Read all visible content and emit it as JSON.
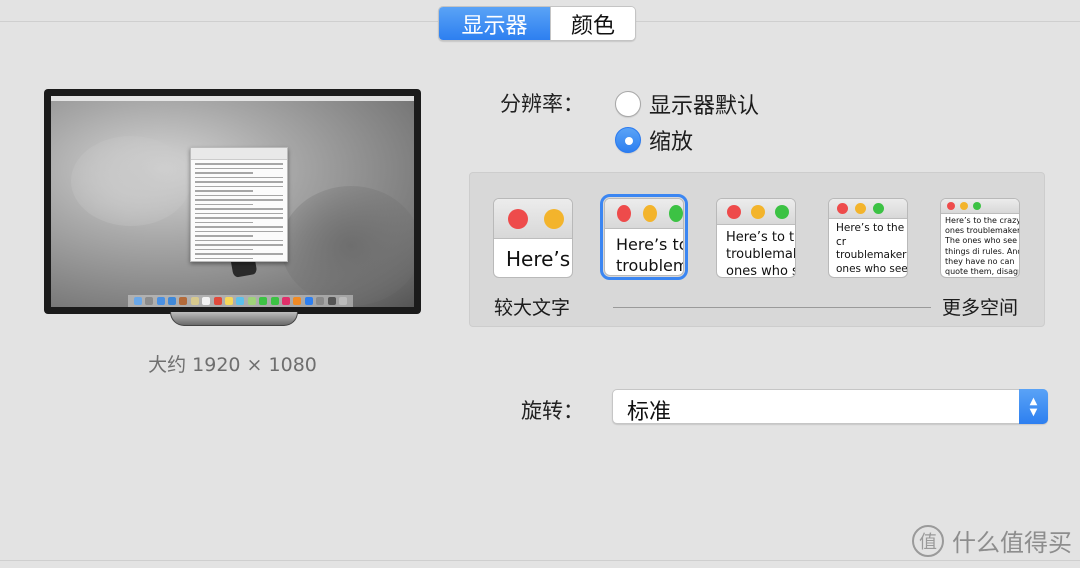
{
  "tabs": {
    "display": "显示器",
    "color": "颜色",
    "active": "display"
  },
  "monitor": {
    "caption": "大约 1920 × 1080"
  },
  "resolution": {
    "label": "分辨率：",
    "options": [
      {
        "label": "显示器默认",
        "selected": false
      },
      {
        "label": "缩放",
        "selected": true
      }
    ],
    "scale_min_label": "较大文字",
    "scale_max_label": "更多空间",
    "previews": [
      {
        "text": "Here’s",
        "selected": false
      },
      {
        "text": "Here’s to troublem",
        "selected": true
      },
      {
        "text": "Here’s to th troublemak ones who s",
        "selected": false
      },
      {
        "text": "Here’s to the cr troublemakers. ones who see t rules. And they",
        "selected": false
      },
      {
        "text": "Here’s to the crazy ones troublemakers. The ones who see things di rules. And they have no can quote them, disagre about the only Because they change t",
        "selected": false
      }
    ]
  },
  "rotation": {
    "label": "旋转：",
    "value": "标准"
  },
  "watermark": {
    "text": "什么值得买",
    "icon": "zhi-logo-icon"
  },
  "colors": {
    "accent": "#2d7ff0",
    "red": "#ee4b4b",
    "yellow": "#f3b42c",
    "green": "#3cc244"
  }
}
